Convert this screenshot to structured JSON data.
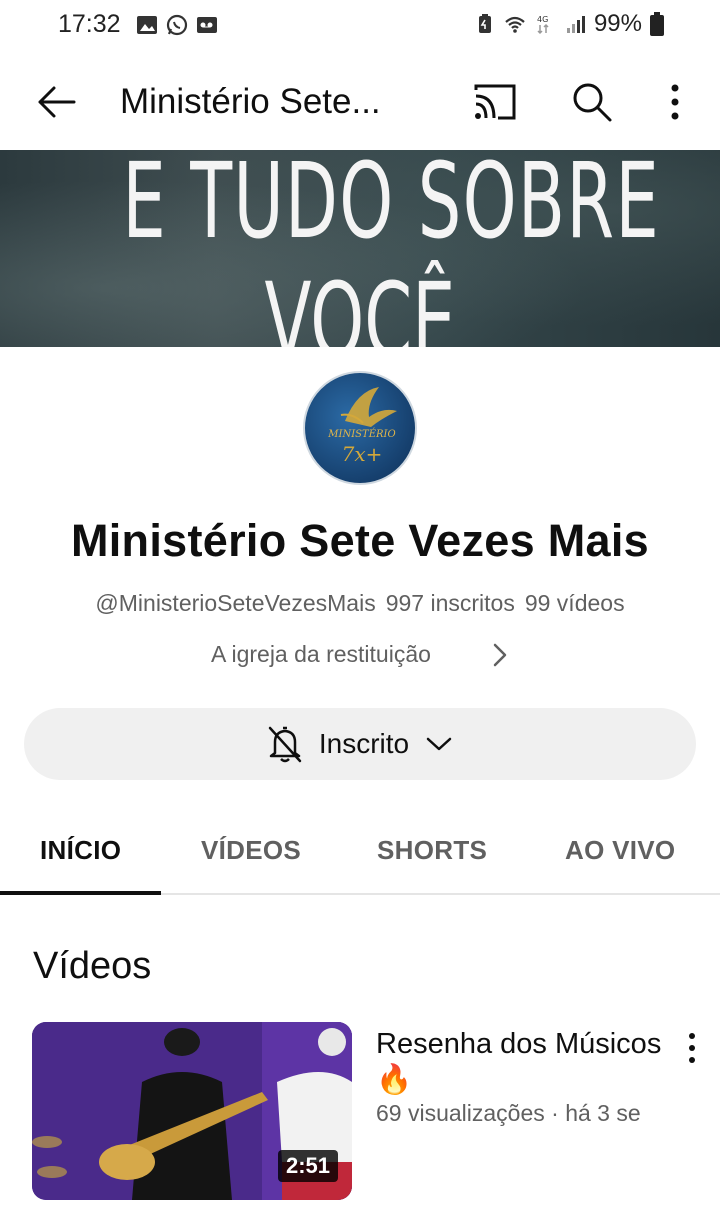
{
  "status_bar": {
    "time": "17:32",
    "battery": "99%",
    "network": "4G"
  },
  "app_bar": {
    "title": "Ministério Sete..."
  },
  "banner": {
    "line1": "E TUDO SOBRE",
    "line2": "VOCÊ"
  },
  "channel": {
    "avatar_text": "MINISTÉRIO 7x+",
    "name": "Ministério Sete Vezes Mais",
    "handle": "@MinisterioSeteVezesMais",
    "subscribers": "997 inscritos",
    "videos_count": "99 vídeos",
    "description": "A igreja da restituição"
  },
  "subscribe": {
    "label": "Inscrito"
  },
  "tabs": [
    {
      "label": "INÍCIO",
      "active": true
    },
    {
      "label": "VÍDEOS",
      "active": false
    },
    {
      "label": "SHORTS",
      "active": false
    },
    {
      "label": "AO VIVO",
      "active": false
    }
  ],
  "section": {
    "title": "Vídeos"
  },
  "videos": [
    {
      "title": "Resenha dos Músicos 🔥",
      "meta": "69 visualizações · há 3 se",
      "duration": "2:51"
    }
  ],
  "colors": {
    "primary_text": "#0f0f0f",
    "secondary_text": "#606060",
    "button_bg": "#f0f0f0"
  }
}
